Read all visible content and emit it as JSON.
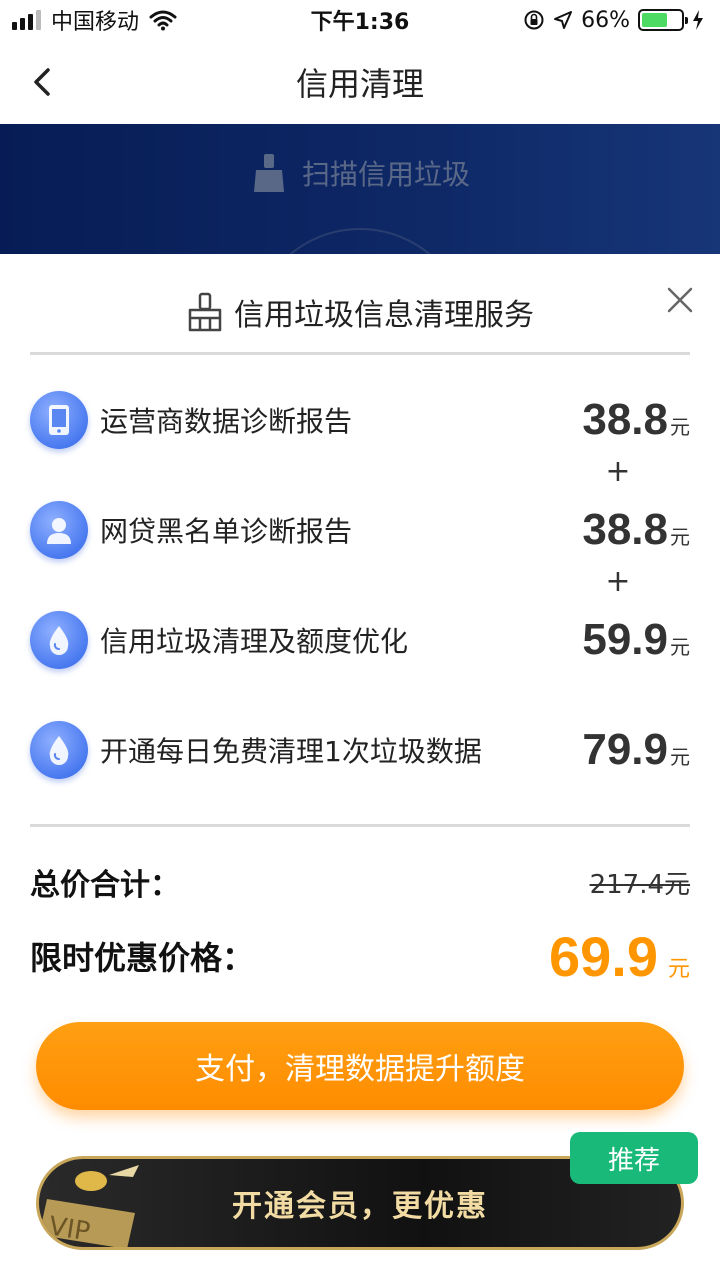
{
  "status_bar": {
    "carrier": "中国移动",
    "time": "下午1:36",
    "battery_percent": "66%",
    "battery_level": 0.66,
    "icons": [
      "signal-icon",
      "wifi-icon",
      "orientation-lock-icon",
      "location-icon",
      "battery-icon",
      "charging-icon"
    ]
  },
  "nav": {
    "title": "信用清理",
    "back_icon": "chevron-left-icon"
  },
  "banner": {
    "label": "扫描信用垃圾",
    "icon": "broom-icon"
  },
  "sheet": {
    "title": "信用垃圾信息清理服务",
    "title_icon": "broom-icon",
    "close_icon": "close-icon",
    "items": [
      {
        "label": "运营商数据诊断报告",
        "price": "38.8",
        "unit": "元",
        "icon": "phone-icon"
      },
      {
        "label": "网贷黑名单诊断报告",
        "price": "38.8",
        "unit": "元",
        "icon": "person-icon"
      },
      {
        "label": "信用垃圾清理及额度优化",
        "price": "59.9",
        "unit": "元",
        "icon": "drop-icon"
      },
      {
        "label": "开通每日免费清理1次垃圾数据",
        "price": "79.9",
        "unit": "元",
        "icon": "drop-icon"
      }
    ],
    "plus": "+",
    "total_label": "总价合计：",
    "total_original": "217.4元",
    "promo_label": "限时优惠价格：",
    "promo_price": "69.9",
    "promo_unit": "元",
    "pay_button": "支付，清理数据提升额度",
    "vip_label": "开通会员，更优惠",
    "vip_badge_text": "VIP",
    "recommend_badge": "推荐"
  },
  "colors": {
    "accent_orange": "#ff9600",
    "banner_blue": "#173f9e",
    "recommend_green": "#19b979",
    "vip_gold": "#c9a75a"
  }
}
